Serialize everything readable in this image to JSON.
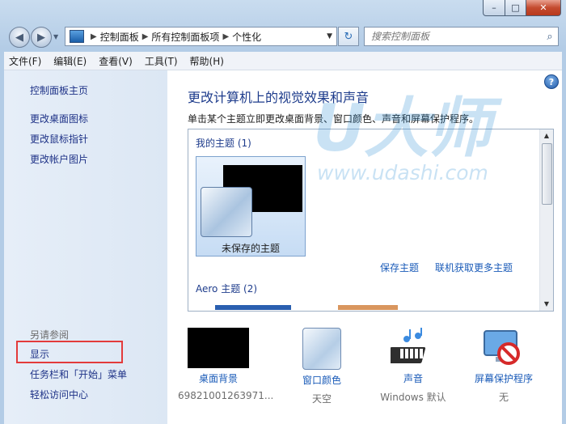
{
  "window": {
    "caption_min": "–",
    "caption_max": "□",
    "caption_close": "✕"
  },
  "address_bar": {
    "back_icon": "arrow-left-icon",
    "forward_icon": "arrow-right-icon",
    "crumbs": [
      "控制面板",
      "所有控制面板项",
      "个性化"
    ],
    "search_placeholder": "搜索控制面板"
  },
  "menu": [
    "文件(F)",
    "编辑(E)",
    "查看(V)",
    "工具(T)",
    "帮助(H)"
  ],
  "left_pane": {
    "links": [
      "控制面板主页",
      "更改桌面图标",
      "更改鼠标指针",
      "更改帐户图片"
    ],
    "see_also_label": "另请参阅",
    "see_also": [
      "显示",
      "任务栏和「开始」菜单",
      "轻松访问中心"
    ]
  },
  "main": {
    "title": "更改计算机上的视觉效果和声音",
    "subtitle": "单击某个主题立即更改桌面背景、窗口颜色、声音和屏幕保护程序。",
    "group_my_themes": "我的主题 (1)",
    "unsaved_theme": "未保存的主题",
    "save_theme_link": "保存主题",
    "get_more_link": "联机获取更多主题",
    "group_aero": "Aero 主题 (2)",
    "watermark_big": "U大师",
    "watermark_url": "www.udashi.com"
  },
  "bottom_items": [
    {
      "label": "桌面背景",
      "value": "69821001263971..."
    },
    {
      "label": "窗口颜色",
      "value": "天空"
    },
    {
      "label": "声音",
      "value": "Windows 默认"
    },
    {
      "label": "屏幕保护程序",
      "value": "无"
    }
  ],
  "colors": {
    "link": "#1a5bb8",
    "title": "#1e3c8c",
    "highlight_box": "#e33b3b"
  }
}
